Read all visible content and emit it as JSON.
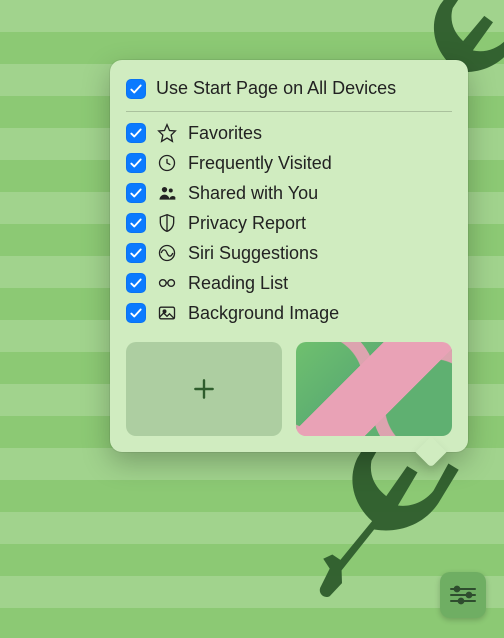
{
  "popover": {
    "header": {
      "label": "Use Start Page on All Devices",
      "checked": true
    },
    "items": [
      {
        "icon": "star",
        "label": "Favorites",
        "checked": true
      },
      {
        "icon": "clock",
        "label": "Frequently Visited",
        "checked": true
      },
      {
        "icon": "people",
        "label": "Shared with You",
        "checked": true
      },
      {
        "icon": "shield",
        "label": "Privacy Report",
        "checked": true
      },
      {
        "icon": "siri",
        "label": "Siri Suggestions",
        "checked": true
      },
      {
        "icon": "glasses",
        "label": "Reading List",
        "checked": true
      },
      {
        "icon": "image",
        "label": "Background Image",
        "checked": true
      }
    ],
    "thumbs": {
      "add_label": "+",
      "preview_name": "butterfly-wallpaper"
    }
  },
  "settings_button": {
    "name": "customize-start-page-button"
  }
}
